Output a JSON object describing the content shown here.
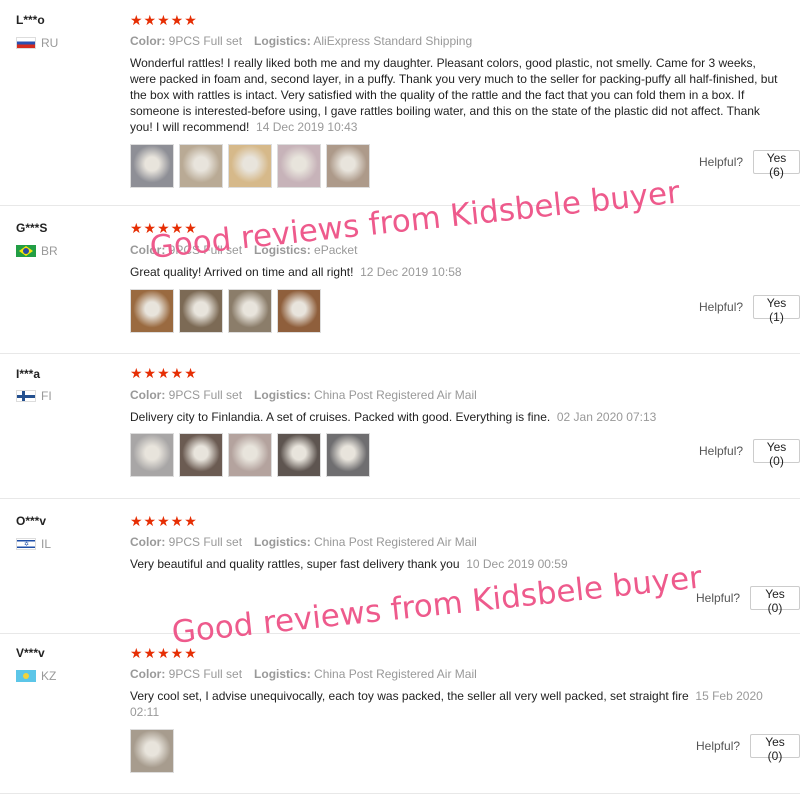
{
  "labels": {
    "color": "Color:",
    "logistics": "Logistics:",
    "helpful": "Helpful?"
  },
  "watermarks": [
    "Good reviews from Kidsbele buyer",
    "Good reviews from Kidsbele buyer"
  ],
  "colors": {
    "stars": "#e62e04",
    "watermark": "#ee5a8c",
    "muted": "#999999"
  },
  "reviews": [
    {
      "user": "L***o",
      "country": "RU",
      "flag": "russia-flag-icon",
      "stars": "★★★★★",
      "color": "9PCS Full set",
      "logistics": "AliExpress Standard Shipping",
      "text": "Wonderful rattles! I really liked both me and my daughter. Pleasant colors, good plastic, not smelly. Came for 3 weeks, were packed in foam and, second layer, in a puffy. Thank you very much to the seller for packing-puffy all half-finished, but the box with rattles is intact. Very satisfied with the quality of the rattle and the fact that you can fold them in a box. If someone is interested-before using, I gave rattles boiling water, and this on the state of the plastic did not affect. Thank you! I will recommend!",
      "date": "14 Dec 2019 10:43",
      "yes": "Yes (6)",
      "photos": [
        "#8e8f96",
        "#b9aa95",
        "#d6b98a",
        "#c7b3b9",
        "#ad9a8a"
      ]
    },
    {
      "user": "G***S",
      "country": "BR",
      "flag": "brazil-flag-icon",
      "stars": "★★★★★",
      "color": "9PCS Full set",
      "logistics": "ePacket",
      "text": "Great quality! Arrived on time and all right!",
      "date": "12 Dec 2019 10:58",
      "yes": "Yes (1)",
      "photos": [
        "#9a6a40",
        "#7c6a55",
        "#8b7d6a",
        "#8f5f3c"
      ]
    },
    {
      "user": "I***a",
      "country": "FI",
      "flag": "finland-flag-icon",
      "stars": "★★★★★",
      "color": "9PCS Full set",
      "logistics": "China Post Registered Air Mail",
      "text": "Delivery city to Finlandia. A set of cruises. Packed with good. Everything is fine.",
      "date": "02 Jan 2020 07:13",
      "yes": "Yes (0)",
      "photos": [
        "#a8a6a6",
        "#6b5b52",
        "#b4a39e",
        "#5e5550",
        "#6f6e70"
      ]
    },
    {
      "user": "O***v",
      "country": "IL",
      "flag": "israel-flag-icon",
      "stars": "★★★★★",
      "color": "9PCS Full set",
      "logistics": "China Post Registered Air Mail",
      "text": "Very beautiful and quality rattles, super fast delivery thank you",
      "date": "10 Dec 2019 00:59",
      "yes": "Yes (0)",
      "photos": []
    },
    {
      "user": "V***v",
      "country": "KZ",
      "flag": "kazakhstan-flag-icon",
      "stars": "★★★★★",
      "color": "9PCS Full set",
      "logistics": "China Post Registered Air Mail",
      "text": "Very cool set, I advise unequivocally, each toy was packed, the seller all very well packed, set straight fire",
      "date": "15 Feb 2020 02:11",
      "yes": "Yes (0)",
      "photos": [
        "#a79c8e"
      ]
    }
  ]
}
